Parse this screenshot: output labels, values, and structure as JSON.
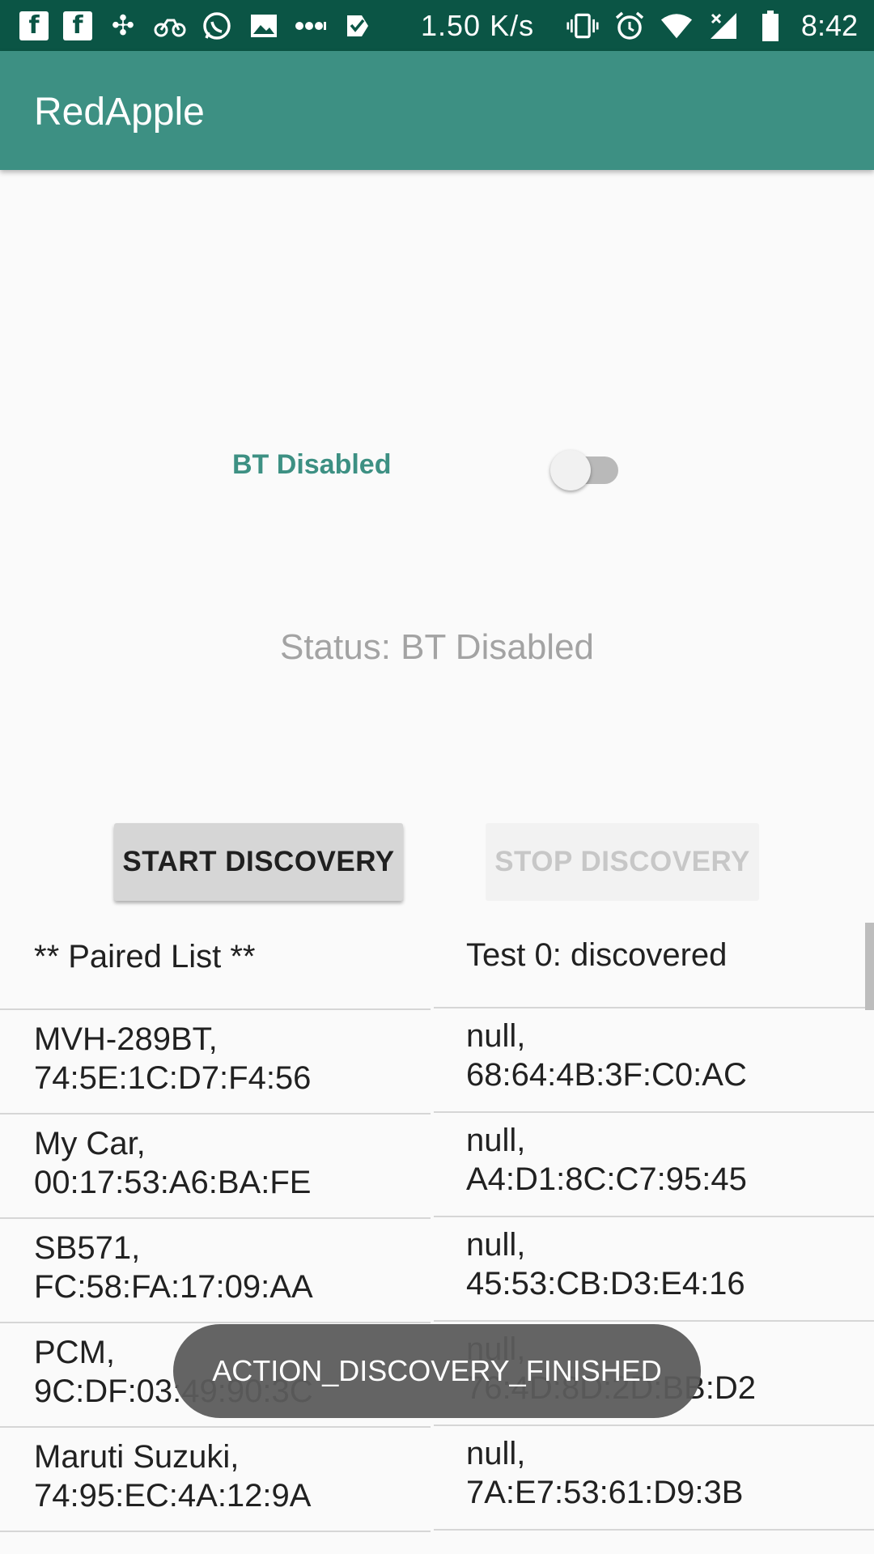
{
  "status_bar": {
    "notification_icons": [
      "facebook-icon",
      "facebook-icon",
      "pinwheel-icon",
      "bicycle-icon",
      "whatsapp-icon",
      "image-icon",
      "more-dots-icon",
      "checkbox-icon"
    ],
    "network_speed": "1.50 K/s",
    "system_icons": [
      "vibrate-icon",
      "alarm-icon",
      "wifi-icon",
      "signal-icon",
      "battery-icon"
    ],
    "time": "8:42"
  },
  "app_bar": {
    "title": "RedApple"
  },
  "bluetooth": {
    "label": "BT Disabled",
    "switch_on": false,
    "status": "Status: BT Disabled"
  },
  "buttons": {
    "start_discovery": "START DISCOVERY",
    "stop_discovery": "STOP DISCOVERY",
    "stop_enabled": false
  },
  "paired_list": {
    "header": "** Paired List **",
    "items": [
      [
        "MVH-289BT,",
        "74:5E:1C:D7:F4:56"
      ],
      [
        "My Car,",
        "00:17:53:A6:BA:FE"
      ],
      [
        "SB571,",
        "FC:58:FA:17:09:AA"
      ],
      [
        "PCM,",
        "9C:DF:03:49:90:3C"
      ],
      [
        "Maruti Suzuki,",
        "74:95:EC:4A:12:9A"
      ]
    ]
  },
  "discovered_list": {
    "header": "Test 0: discovered",
    "items": [
      [
        "null,",
        "68:64:4B:3F:C0:AC"
      ],
      [
        "null,",
        "A4:D1:8C:C7:95:45"
      ],
      [
        "null,",
        "45:53:CB:D3:E4:16"
      ],
      [
        "null,",
        "76:4D:8D:2D:BB:D2"
      ],
      [
        "null,",
        "7A:E7:53:61:D9:3B"
      ]
    ]
  },
  "toast": {
    "message": "ACTION_DISCOVERY_FINISHED"
  },
  "colors": {
    "status_bar": "#0b5545",
    "app_bar": "#3d9083",
    "accent_text": "#3d9083",
    "background": "#fafafa"
  }
}
